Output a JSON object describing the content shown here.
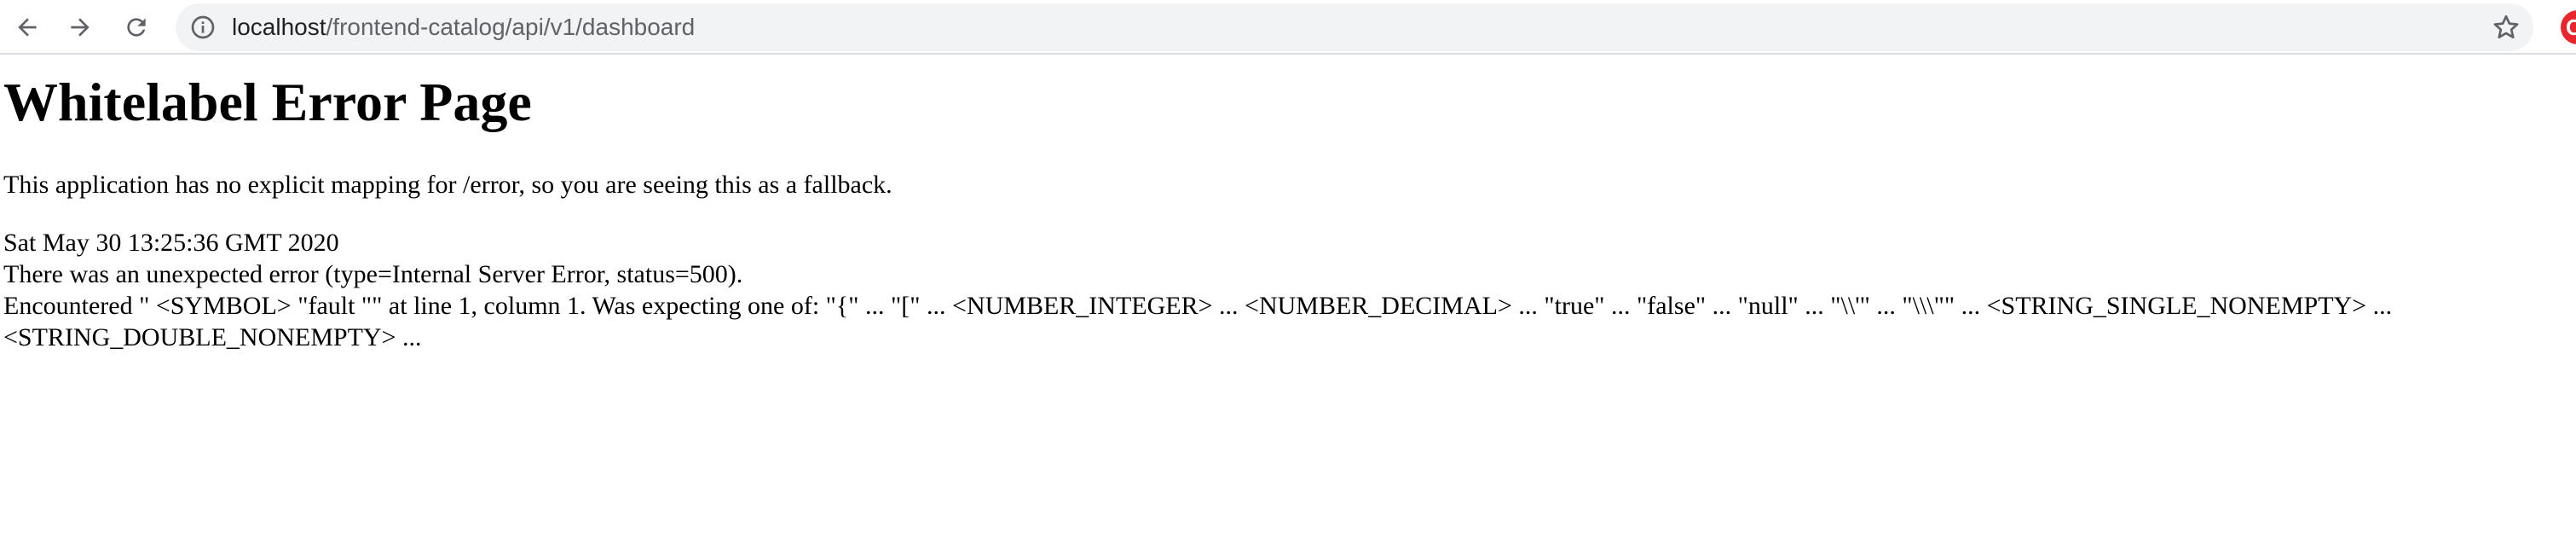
{
  "browser": {
    "url_host": "localhost",
    "url_path": "/frontend-catalog/api/v1/dashboard",
    "profile_initial": "C"
  },
  "page": {
    "title": "Whitelabel Error Page",
    "description": "This application has no explicit mapping for /error, so you are seeing this as a fallback.",
    "timestamp": "Sat May 30 13:25:36 GMT 2020",
    "error_summary": "There was an unexpected error (type=Internal Server Error, status=500).",
    "error_detail_line1": "Encountered \" <SYMBOL> \"fault \"\" at line 1, column 1. Was expecting one of: \"{\" ... \"[\" ... <NUMBER_INTEGER> ... <NUMBER_DECIMAL> ... \"true\" ... \"false\" ... \"null\" ... \"\\\\'\" ... \"\\\\\\\"\" ... <STRING_SINGLE_NONEMPTY> ...",
    "error_detail_line2": "<STRING_DOUBLE_NONEMPTY> ..."
  }
}
